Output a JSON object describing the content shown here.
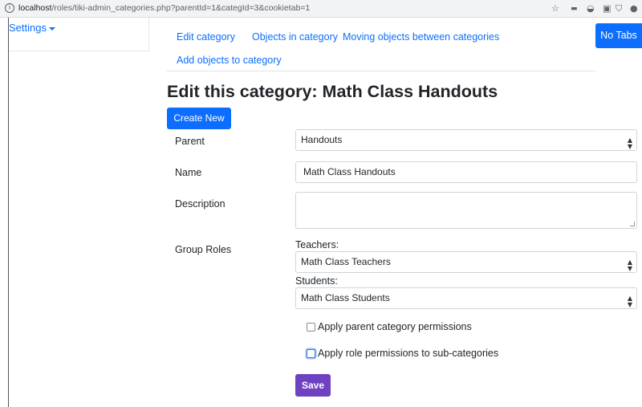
{
  "browser": {
    "url_host": "localhost",
    "url_path": "/roles/tiki-admin_categories.php?parentId=1&categId=3&cookietab=1"
  },
  "settings": {
    "label": "Settings"
  },
  "tabs": [
    {
      "label": "Edit category"
    },
    {
      "label": "Objects in category"
    },
    {
      "label": "Moving objects between categories"
    },
    {
      "label": "Add objects to category"
    }
  ],
  "no_tabs_label": "No Tabs",
  "page": {
    "title_prefix": "Edit this category: ",
    "title_name": "Math Class Handouts",
    "create_new_label": "Create New"
  },
  "form": {
    "parent": {
      "label": "Parent",
      "selected": "Handouts"
    },
    "name": {
      "label": "Name",
      "value": "Math Class Handouts"
    },
    "description": {
      "label": "Description",
      "value": ""
    },
    "group_roles": {
      "label": "Group Roles",
      "teachers": {
        "label": "Teachers:",
        "selected": "Math Class Teachers"
      },
      "students": {
        "label": "Students:",
        "selected": "Math Class Students"
      }
    },
    "apply_parent_permissions": {
      "label": "Apply parent category permissions",
      "checked": false
    },
    "apply_role_permissions": {
      "label": "Apply role permissions to sub-categories",
      "checked": false
    },
    "save_label": "Save"
  },
  "colors": {
    "primary": "#0d6efd",
    "save": "#6f42c1"
  }
}
